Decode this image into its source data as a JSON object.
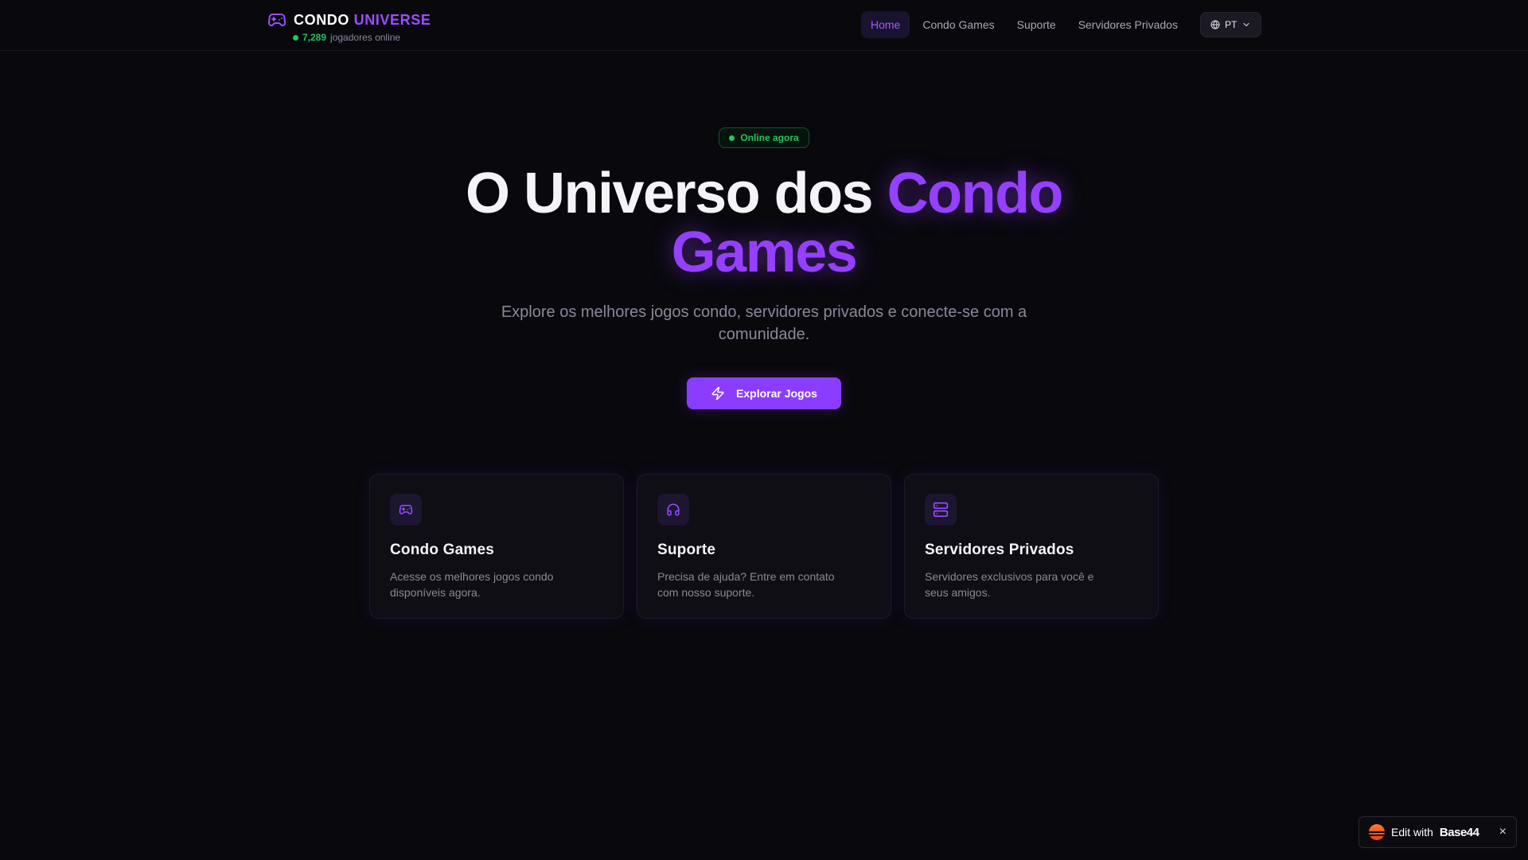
{
  "header": {
    "brand_part1": "CONDO",
    "brand_part2": "UNIVERSE",
    "online_count": "7,289",
    "online_label": "jogadores online",
    "nav": [
      {
        "label": "Home",
        "active": true
      },
      {
        "label": "Condo Games",
        "active": false
      },
      {
        "label": "Suporte",
        "active": false
      },
      {
        "label": "Servidores Privados",
        "active": false
      }
    ],
    "language": "PT"
  },
  "hero": {
    "badge": "Online agora",
    "title_part1": "O Universo dos",
    "title_part2": "Condo Games",
    "subtitle": "Explore os melhores jogos condo, servidores privados e conecte-se com a comunidade.",
    "cta_label": "Explorar Jogos"
  },
  "cards": [
    {
      "icon": "gamepad-icon",
      "title": "Condo Games",
      "description": "Acesse os melhores jogos condo disponíveis agora."
    },
    {
      "icon": "headphones-icon",
      "title": "Suporte",
      "description": "Precisa de ajuda? Entre em contato com nosso suporte."
    },
    {
      "icon": "server-icon",
      "title": "Servidores Privados",
      "description": "Servidores exclusivos para você e seus amigos."
    }
  ],
  "edit_badge": {
    "label": "Edit with",
    "brand": "Base44",
    "close": "×"
  },
  "colors": {
    "background": "#09080d",
    "accent": "#9b4dff",
    "online_green": "#22c55e",
    "card_background": "#0f0e14"
  }
}
